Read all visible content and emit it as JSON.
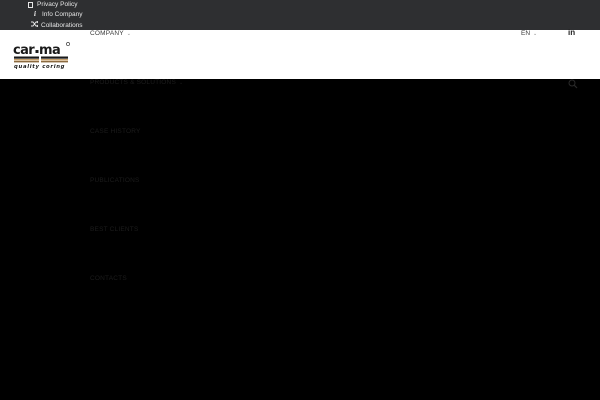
{
  "topbar": {
    "links": [
      {
        "label": "Privacy Policy",
        "icon": "document-icon"
      },
      {
        "label": "Info Company",
        "icon": "info-icon"
      },
      {
        "label": "Collaborations",
        "icon": "shuffle-icon"
      }
    ]
  },
  "header": {
    "logo": {
      "text": "car.ma",
      "tagline": "quality coring"
    },
    "nav_company": "COMPANY",
    "language": "EN",
    "linkedin": "in"
  },
  "menu": {
    "items": [
      {
        "label": "PRODUCTS & SOLUTIONS"
      },
      {
        "label": "CASE HISTORY"
      },
      {
        "label": "PUBLICATIONS"
      },
      {
        "label": "BEST CLIENTS"
      },
      {
        "label": "CONTACTS"
      }
    ]
  },
  "colors": {
    "topbar_bg": "#2e2f31",
    "header_bg": "#ffffff",
    "page_bg": "#000000",
    "logo_accent": "#c8a06a"
  }
}
